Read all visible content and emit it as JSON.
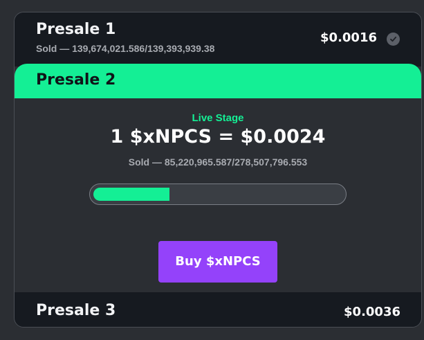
{
  "presales": [
    {
      "title": "Presale 1",
      "sold": "Sold — 139,674,021.586/139,393,939.38",
      "price": "$0.0016",
      "status_icon": "check-circle-icon"
    },
    {
      "title": "Presale 2",
      "stage_label": "Live Stage",
      "rate": "1 $xNPCS = $0.0024",
      "sold": "Sold — 85,220,965.587/278,507,796.553",
      "progress_fraction": 0.306,
      "buy_label": "Buy $xNPCS"
    },
    {
      "title": "Presale 3",
      "price": "$0.0036"
    }
  ],
  "colors": {
    "accent": "#14ef95",
    "button": "#9442fa",
    "row_background": "#161a20",
    "card_background": "#2b2e33"
  }
}
